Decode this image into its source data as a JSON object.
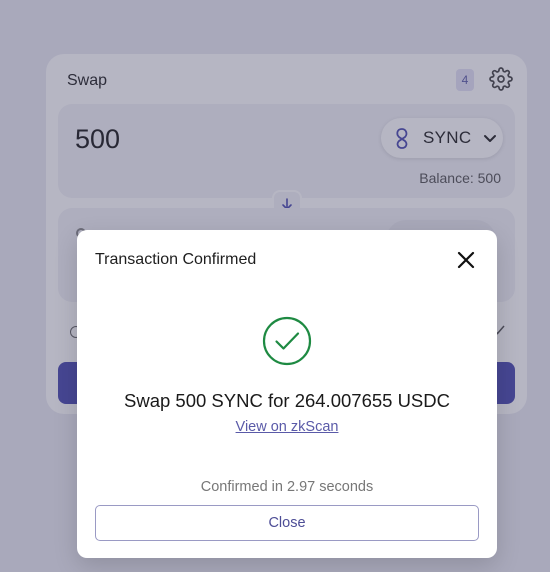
{
  "swap": {
    "header": "Swap",
    "count_badge": "4",
    "amount": "500",
    "token": "SYNC",
    "balance": "Balance: 500",
    "colors": {
      "accent": "#4b4bb0"
    }
  },
  "modal": {
    "title": "Transaction Confirmed",
    "summary": "Swap 500 SYNC for 264.007655 USDC",
    "link_label": "View on zkScan",
    "confirmed_text": "Confirmed in 2.97 seconds",
    "close_label": "Close",
    "icons": {
      "close": "close-icon",
      "success": "check-circle-icon"
    },
    "colors": {
      "success": "#1e8a42",
      "link": "#5a5aa8"
    }
  }
}
